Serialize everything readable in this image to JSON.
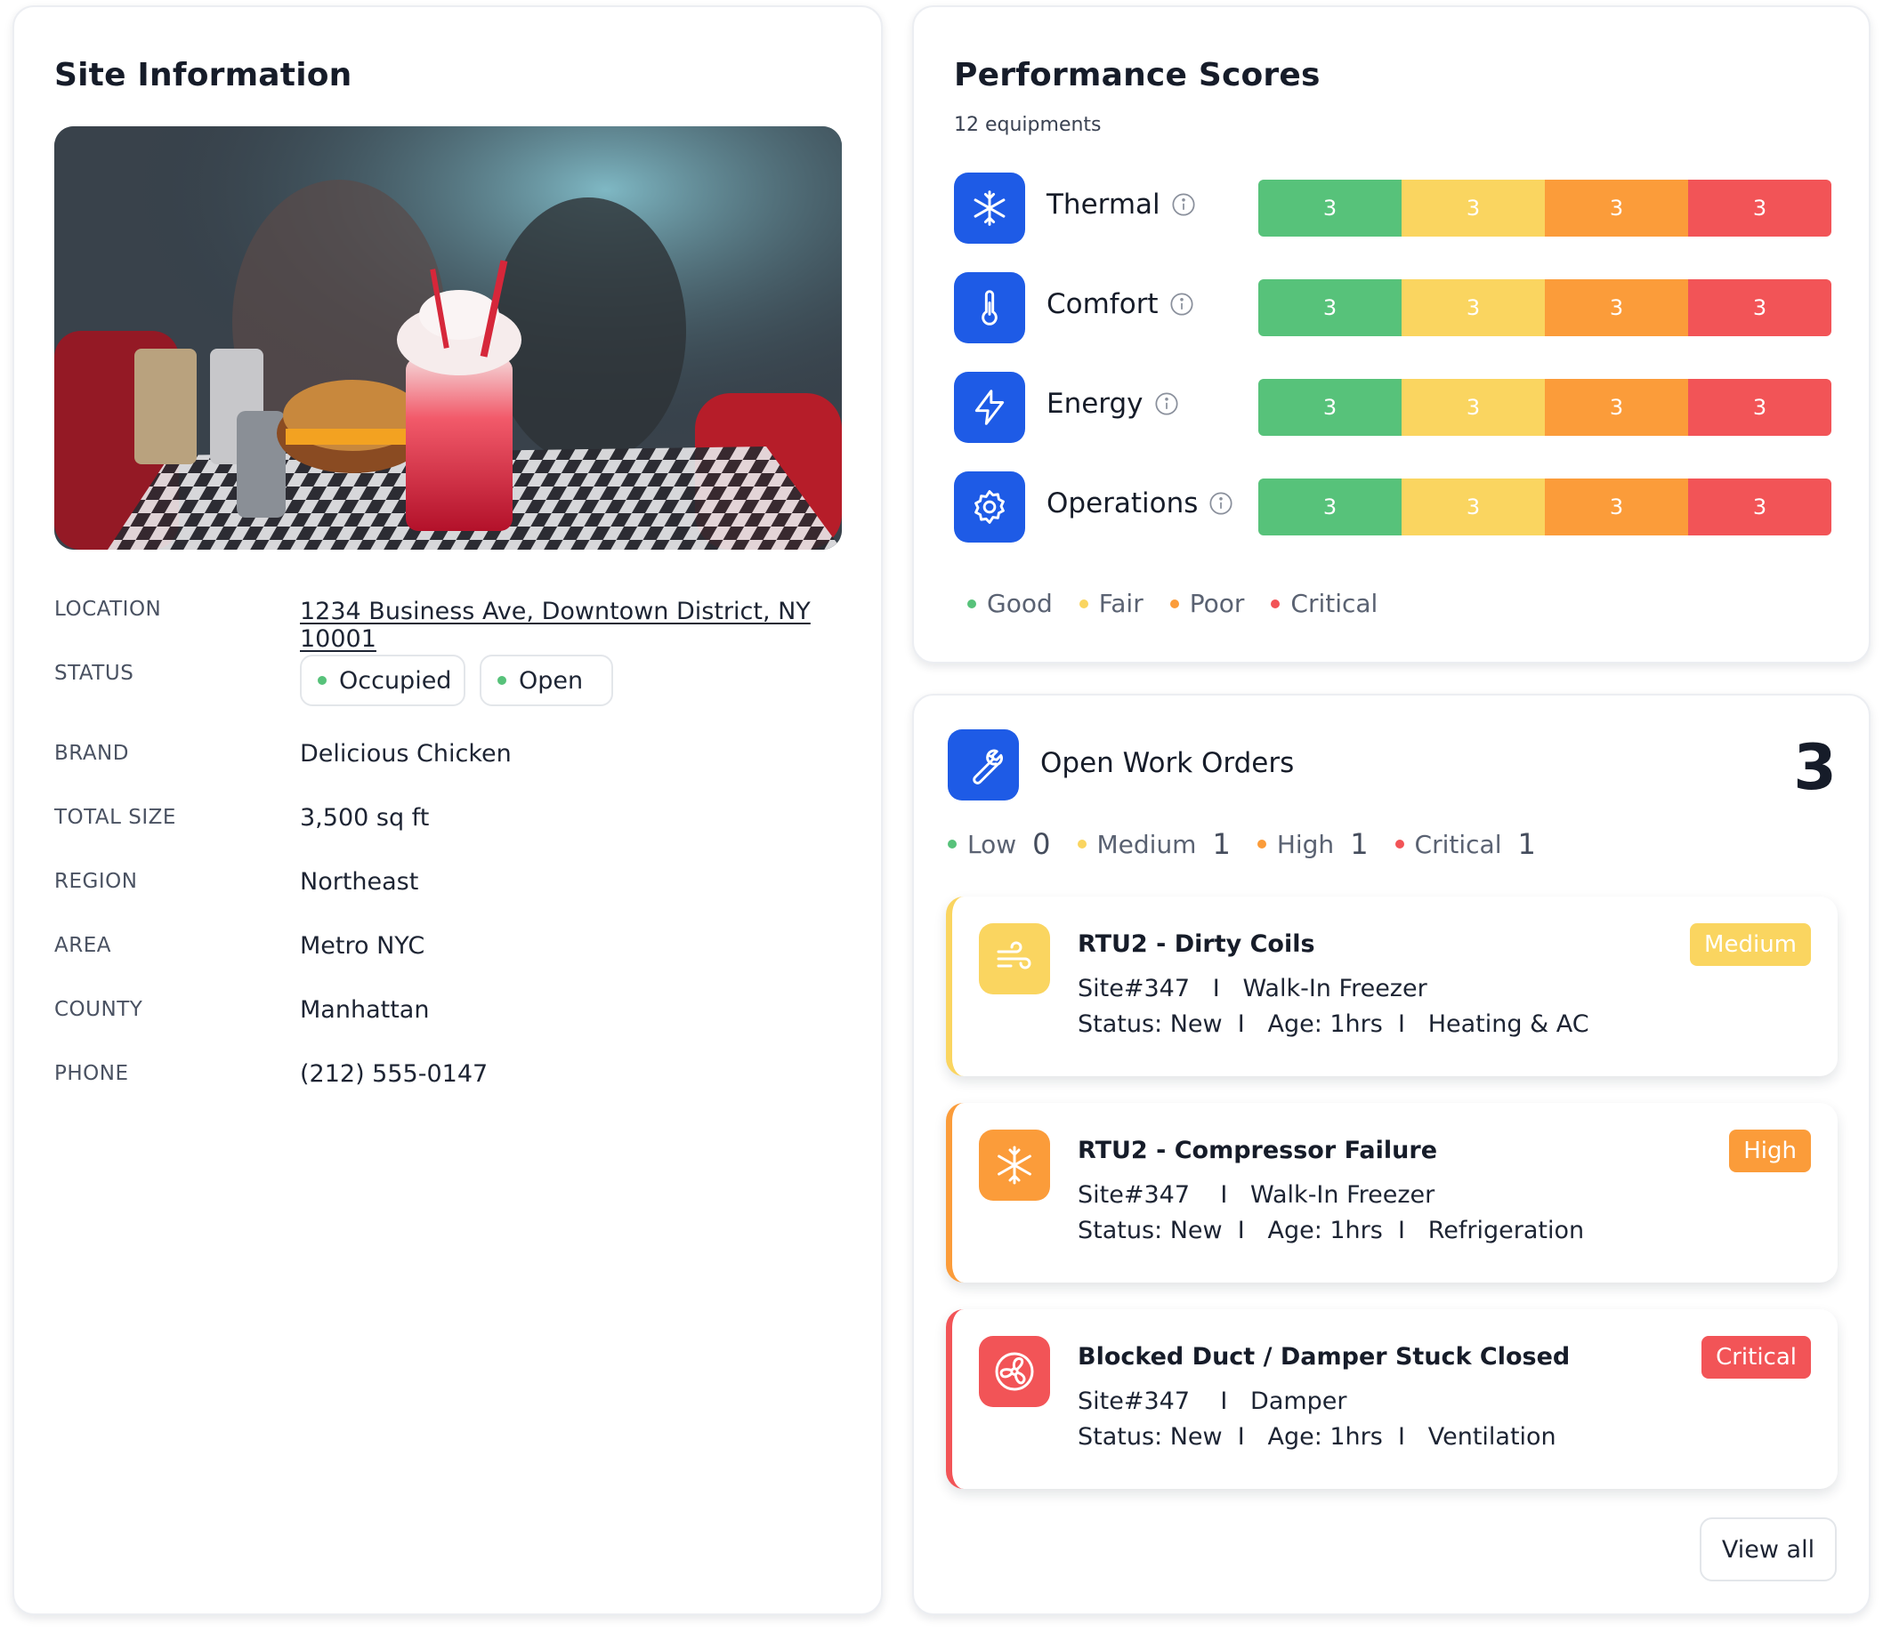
{
  "site": {
    "title": "Site Information",
    "fields": {
      "location_label": "LOCATION",
      "location_value": "1234 Business Ave, Downtown District, NY 10001",
      "status_label": "STATUS",
      "status_occupied": "Occupied",
      "status_open": "Open",
      "brand_label": "BRAND",
      "brand_value": "Delicious Chicken",
      "size_label": "TOTAL SIZE",
      "size_value": "3,500 sq ft",
      "region_label": "REGION",
      "region_value": "Northeast",
      "area_label": "AREA",
      "area_value": "Metro NYC",
      "county_label": "COUNTY",
      "county_value": "Manhattan",
      "phone_label": "PHONE",
      "phone_value": "(212) 555-0147"
    }
  },
  "performance": {
    "title": "Performance Scores",
    "subtitle": "12 equipments",
    "rows": [
      {
        "name": "Thermal",
        "icon": "snowflake-icon",
        "good": "3",
        "fair": "3",
        "poor": "3",
        "critical": "3"
      },
      {
        "name": "Comfort",
        "icon": "thermometer-icon",
        "good": "3",
        "fair": "3",
        "poor": "3",
        "critical": "3"
      },
      {
        "name": "Energy",
        "icon": "lightning-icon",
        "good": "3",
        "fair": "3",
        "poor": "3",
        "critical": "3"
      },
      {
        "name": "Operations",
        "icon": "gear-icon",
        "good": "3",
        "fair": "3",
        "poor": "3",
        "critical": "3"
      }
    ],
    "legend": {
      "good": "Good",
      "fair": "Fair",
      "poor": "Poor",
      "critical": "Critical"
    }
  },
  "work_orders": {
    "title": "Open Work Orders",
    "count": "3",
    "legend": {
      "low_label": "Low",
      "low_count": "0",
      "medium_label": "Medium",
      "medium_count": "1",
      "high_label": "High",
      "high_count": "1",
      "critical_label": "Critical",
      "critical_count": "1"
    },
    "items": [
      {
        "name": "RTU2 - Dirty Coils",
        "icon": "wind-icon",
        "priority": "Medium",
        "site_line": "Site#347   I   Walk-In Freezer",
        "status_line": "Status: New  I   Age: 1hrs  I   Heating & AC"
      },
      {
        "name": "RTU2 - Compressor Failure",
        "icon": "snowflake-icon",
        "priority": "High",
        "site_line": "Site#347    I   Walk-In Freezer",
        "status_line": "Status: New  I   Age: 1hrs  I   Refrigeration"
      },
      {
        "name": "Blocked Duct / Damper Stuck Closed",
        "icon": "fan-icon",
        "priority": "Critical",
        "site_line": "Site#347    I   Damper",
        "status_line": "Status: New  I   Age: 1hrs  I   Ventilation"
      }
    ],
    "view_all": "View all"
  },
  "colors": {
    "good": "#57c27a",
    "fair": "#fad560",
    "poor": "#fb9c3a",
    "critical": "#f25457",
    "brand_blue": "#1e5be6"
  }
}
